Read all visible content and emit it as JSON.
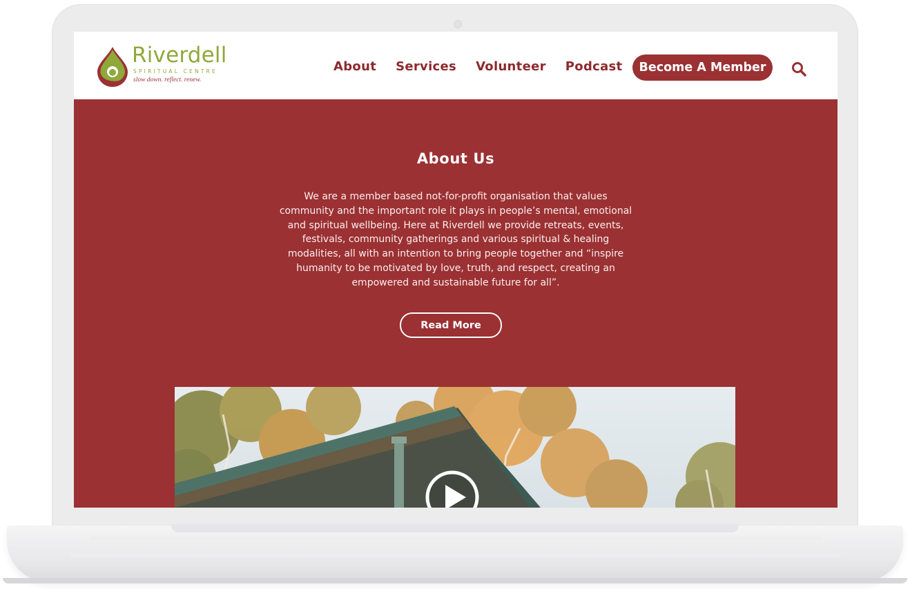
{
  "logo": {
    "name": "Riverdell",
    "subtitle": "SPIRITUAL CENTRE",
    "tagline": "slow down. reflect. renew.",
    "colors": {
      "green": "#8fa83a",
      "red": "#a23538"
    }
  },
  "nav": {
    "items": [
      {
        "label": "About"
      },
      {
        "label": "Services"
      },
      {
        "label": "Volunteer"
      },
      {
        "label": "Podcast"
      }
    ],
    "cta_label": "Become A Member",
    "search_icon": "search-icon"
  },
  "about": {
    "title": "About Us",
    "body": "We are a member based not-for-profit organisation that values community and the important role it plays in people’s mental, emotional and spiritual wellbeing. Here at Riverdell we provide retreats, events, festivals, community gatherings and various spiritual & healing modalities, all with an intention to bring people together and “inspire humanity to be motivated by love, truth, and respect, creating an empowered and sustainable future for all”.",
    "read_more_label": "Read More"
  },
  "video": {
    "play_icon": "play-icon"
  },
  "colors": {
    "brand_red": "#9b3133",
    "header_bg": "#ffffff",
    "text_light": "#ffffff"
  }
}
